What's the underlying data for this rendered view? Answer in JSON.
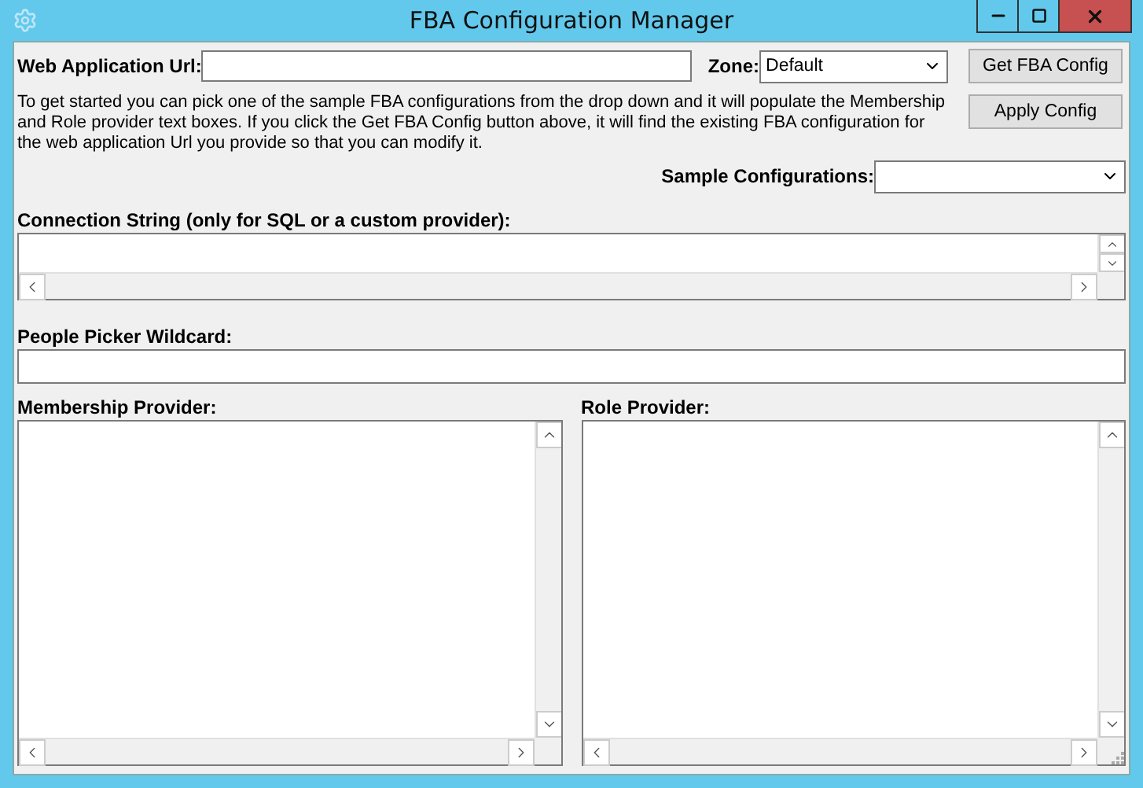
{
  "window": {
    "title": "FBA Configuration Manager"
  },
  "url": {
    "label": "Web Application Url:"
  },
  "zone": {
    "label": "Zone:",
    "value": "Default"
  },
  "buttons": [
    {
      "label": "Get FBA Config"
    },
    {
      "label": "Apply Config"
    }
  ],
  "description": "To get started you can pick one of the sample FBA configurations from the drop down and it will populate the Membership and Role provider text boxes.  If you click the Get FBA Config button above, it will find the existing FBA configuration for the web application Url you provide so that you can modify it.",
  "sample": {
    "label": "Sample Configurations:"
  },
  "connection": {
    "label": "Connection String (only for SQL or a custom provider):"
  },
  "picker": {
    "label": "People Picker Wildcard:"
  },
  "membership": {
    "label": "Membership Provider:"
  },
  "role": {
    "label": "Role Provider:"
  }
}
